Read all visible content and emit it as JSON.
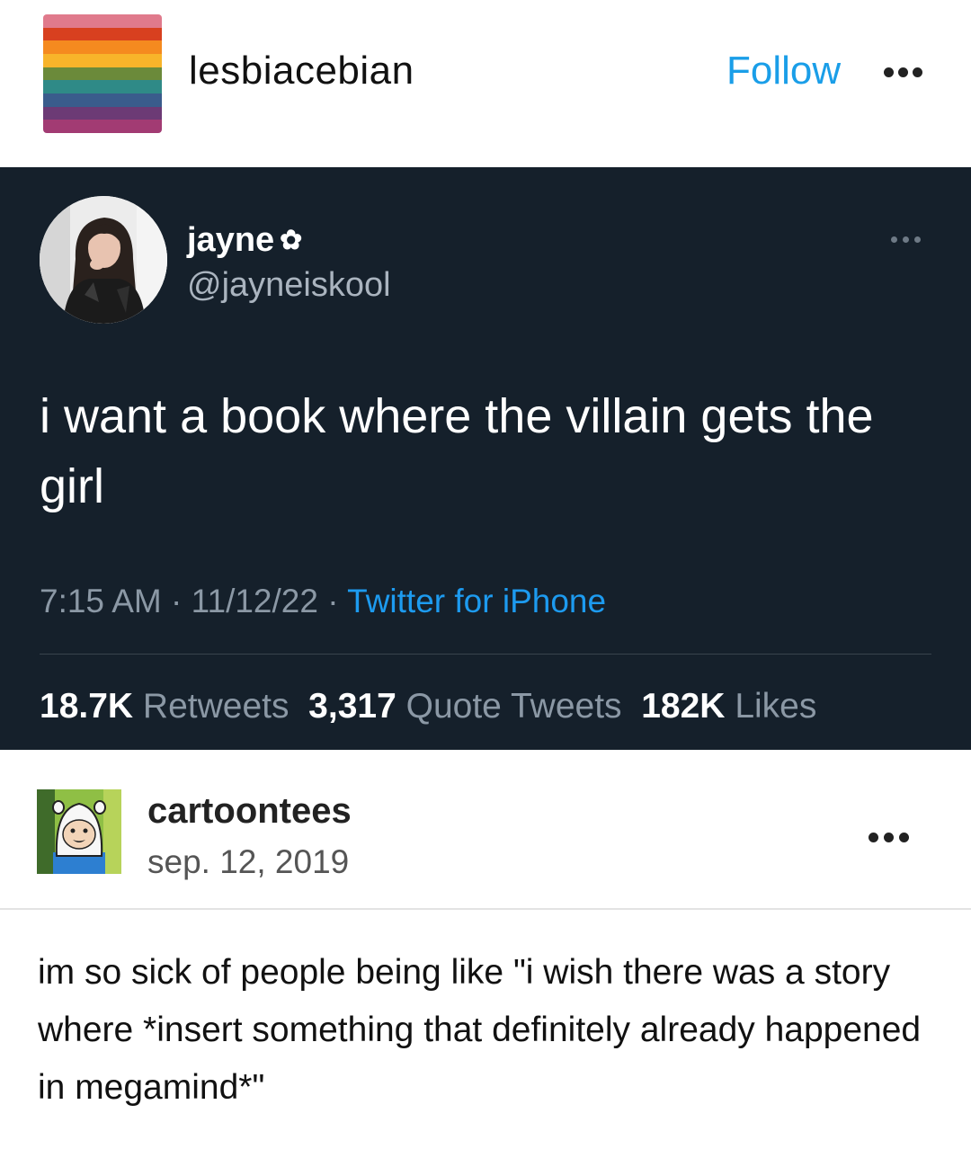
{
  "header": {
    "blog_name": "lesbiacebian",
    "follow_label": "Follow",
    "avatar_stripes": [
      "#e07a8c",
      "#d8401f",
      "#f58a1f",
      "#f8b42a",
      "#6b8a3a",
      "#2f8a87",
      "#3a5c8c",
      "#6c3a75",
      "#a23b73"
    ]
  },
  "tweet": {
    "display_name": "jayne",
    "flower_icon": "✿",
    "handle": "@jayneiskool",
    "text": "i want a book where the villain gets the girl",
    "time": "7:15 AM",
    "separator": " · ",
    "date": "11/12/22",
    "source": "Twitter for iPhone",
    "stats": {
      "retweets_count": "18.7K",
      "retweets_label": "Retweets",
      "quotes_count": "3,317",
      "quotes_label": "Quote Tweets",
      "likes_count": "182K",
      "likes_label": "Likes"
    },
    "colors": {
      "background": "#15202b",
      "link": "#1d9bf0"
    }
  },
  "reblog": {
    "blog_name": "cartoontees",
    "date": "sep. 12, 2019",
    "text": "im so sick of people being like \"i wish there was a story where *insert something that definitely already happened in megamind*\""
  }
}
